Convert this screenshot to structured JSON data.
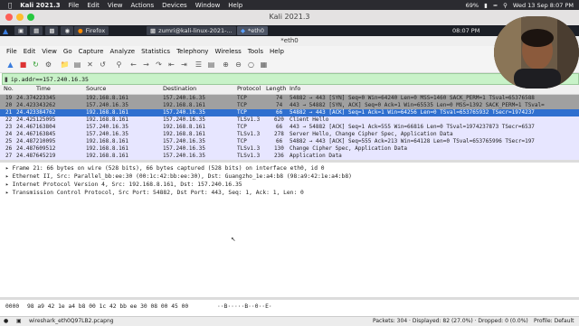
{
  "mac_menubar": {
    "apple": "",
    "app": "Kali 2021.3",
    "items": [
      "File",
      "Edit",
      "View",
      "Actions",
      "Devices",
      "Window",
      "Help"
    ],
    "battery": "69%",
    "datetime": "Wed 13 Sep  8:07 PM"
  },
  "vm": {
    "title": "Kali 2021.3"
  },
  "taskbar": {
    "firefox": "Firefox",
    "terminal": "zumri@kali-linux-2021-...",
    "wireshark": "*eth0",
    "clock": "08:07 PM"
  },
  "wireshark": {
    "title": "*eth0",
    "menu": [
      "File",
      "Edit",
      "View",
      "Go",
      "Capture",
      "Analyze",
      "Statistics",
      "Telephony",
      "Wireless",
      "Tools",
      "Help"
    ],
    "filter": "ip.addr==157.240.16.35",
    "columns": [
      "No.",
      "Time",
      "Source",
      "Destination",
      "Protocol",
      "Length",
      "Info"
    ],
    "rows": [
      {
        "no": "19",
        "time": "24.374223345",
        "src": "192.168.8.161",
        "dst": "157.240.16.35",
        "proto": "TCP",
        "len": "74",
        "info": "54882 → 443 [SYN] Seq=0 Win=64240 Len=0 MSS=1460 SACK_PERM=1 TSval=65376588"
      },
      {
        "no": "20",
        "time": "24.423343262",
        "src": "157.240.16.35",
        "dst": "192.168.8.161",
        "proto": "TCP",
        "len": "74",
        "info": "443 → 54882 [SYN, ACK] Seq=0 Ack=1 Win=65535 Len=0 MSS=1392 SACK_PERM=1 TSval="
      },
      {
        "no": "21",
        "time": "24.423384762",
        "src": "192.168.8.161",
        "dst": "157.240.16.35",
        "proto": "TCP",
        "len": "66",
        "info": "54882 → 443 [ACK] Seq=1 Ack=1 Win=64256 Len=0 TSval=653765932 TSecr=1974237"
      },
      {
        "no": "22",
        "time": "24.425125095",
        "src": "192.168.8.161",
        "dst": "157.240.16.35",
        "proto": "TLSv1.3",
        "len": "620",
        "info": "Client Hello"
      },
      {
        "no": "23",
        "time": "24.467163804",
        "src": "157.240.16.35",
        "dst": "192.168.8.161",
        "proto": "TCP",
        "len": "66",
        "info": "443 → 54882 [ACK] Seq=1 Ack=555 Win=66816 Len=0 TSval=1974237873 TSecr=6537"
      },
      {
        "no": "24",
        "time": "24.467163845",
        "src": "157.240.16.35",
        "dst": "192.168.8.161",
        "proto": "TLSv1.3",
        "len": "278",
        "info": "Server Hello, Change Cipher Spec, Application Data"
      },
      {
        "no": "25",
        "time": "24.487210095",
        "src": "192.168.8.161",
        "dst": "157.240.16.35",
        "proto": "TCP",
        "len": "66",
        "info": "54882 → 443 [ACK] Seq=555 Ack=213 Win=64128 Len=0 TSval=653765996 TSecr=197"
      },
      {
        "no": "26",
        "time": "24.487609512",
        "src": "192.168.8.161",
        "dst": "157.240.16.35",
        "proto": "TLSv1.3",
        "len": "130",
        "info": "Change Cipher Spec, Application Data"
      },
      {
        "no": "27",
        "time": "24.487645219",
        "src": "192.168.8.161",
        "dst": "157.240.16.35",
        "proto": "TLSv1.3",
        "len": "236",
        "info": "Application Data"
      }
    ],
    "details": [
      "Frame 21: 66 bytes on wire (528 bits), 66 bytes captured (528 bits) on interface eth0, id 0",
      "Ethernet II, Src: Parallel_bb:ee:30 (00:1c:42:bb:ee:30), Dst: Guangzho_1e:a4:b8 (98:a9:42:1e:a4:b8)",
      "Internet Protocol Version 4, Src: 192.168.8.161, Dst: 157.240.16.35",
      "Transmission Control Protocol, Src Port: 54882, Dst Port: 443, Seq: 1, Ack: 1, Len: 0"
    ],
    "bytes_offset": "0000",
    "bytes_hex": "98 a9 42 1e a4 b8 00 1c  42 bb ee 30 08 00 45 00",
    "bytes_ascii": "··B·····B··0··E·",
    "status": {
      "file": "wireshark_eth0Q97LB2.pcapng",
      "packets": "Packets: 304 · Displayed: 82 (27.0%) · Dropped: 0 (0.0%)",
      "profile": "Profile: Default"
    }
  },
  "colors": {
    "tcp_row": "#e7e6ff",
    "tls_row": "#e7e6ff",
    "syn_row": "#a0a0a0",
    "selected_row": "#2f6fcf",
    "filter_bg": "#c8f2c8"
  }
}
